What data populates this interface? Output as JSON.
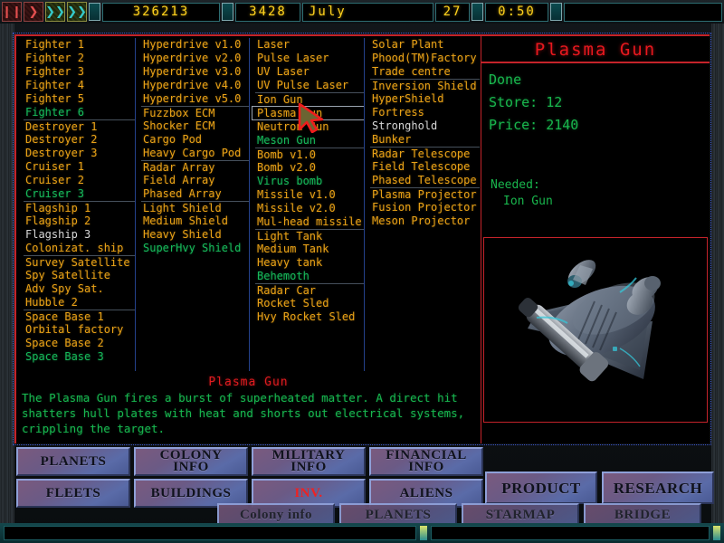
{
  "topbar": {
    "controls": [
      {
        "name": "pause-button",
        "glyph": "❙❙",
        "cls": "pause"
      },
      {
        "name": "play-button",
        "glyph": "❯",
        "cls": "play"
      },
      {
        "name": "fast-forward-button",
        "glyph": "❯❯",
        "cls": "ff"
      },
      {
        "name": "fastest-forward-button",
        "glyph": "❯❯",
        "cls": "ff"
      }
    ],
    "credits": "326213",
    "population": "3428",
    "month": "July",
    "day": "27",
    "clock": "0:50"
  },
  "columns": [
    {
      "name": "ships",
      "items": [
        {
          "label": "Fighter 1",
          "state": "built"
        },
        {
          "label": "Fighter 2",
          "state": "built"
        },
        {
          "label": "Fighter 3",
          "state": "built"
        },
        {
          "label": "Fighter 4",
          "state": "built"
        },
        {
          "label": "Fighter 5",
          "state": "built"
        },
        {
          "label": "Fighter 6",
          "state": "available"
        },
        {
          "label": "Destroyer 1",
          "state": "built",
          "sep": true
        },
        {
          "label": "Destroyer 2",
          "state": "built"
        },
        {
          "label": "Destroyer 3",
          "state": "built"
        },
        {
          "label": "Cruiser 1",
          "state": "built"
        },
        {
          "label": "Cruiser 2",
          "state": "built"
        },
        {
          "label": "Cruiser 3",
          "state": "available"
        },
        {
          "label": "Flagship 1",
          "state": "built",
          "sep": true
        },
        {
          "label": "Flagship 2",
          "state": "built"
        },
        {
          "label": "Flagship 3",
          "state": "researching"
        },
        {
          "label": "Colonizat. ship",
          "state": "built"
        },
        {
          "label": "Survey Satellite",
          "state": "built",
          "sep": true
        },
        {
          "label": "Spy Satellite",
          "state": "built"
        },
        {
          "label": "Adv Spy Sat.",
          "state": "built"
        },
        {
          "label": "Hubble 2",
          "state": "built"
        },
        {
          "label": "Space Base 1",
          "state": "built",
          "sep": true
        },
        {
          "label": "Orbital factory",
          "state": "built"
        },
        {
          "label": "Space Base 2",
          "state": "built"
        },
        {
          "label": "Space Base 3",
          "state": "available"
        }
      ]
    },
    {
      "name": "systems",
      "items": [
        {
          "label": "Hyperdrive v1.0",
          "state": "built"
        },
        {
          "label": "Hyperdrive v2.0",
          "state": "built"
        },
        {
          "label": "Hyperdrive v3.0",
          "state": "built"
        },
        {
          "label": "Hyperdrive v4.0",
          "state": "built"
        },
        {
          "label": "Hyperdrive v5.0",
          "state": "built"
        },
        {
          "label": "Fuzzbox ECM",
          "state": "built",
          "sep": true
        },
        {
          "label": "Shocker ECM",
          "state": "built"
        },
        {
          "label": "Cargo Pod",
          "state": "built"
        },
        {
          "label": "Heavy Cargo Pod",
          "state": "built"
        },
        {
          "label": "Radar Array",
          "state": "built",
          "sep": true
        },
        {
          "label": "Field Array",
          "state": "built"
        },
        {
          "label": "Phased Array",
          "state": "built"
        },
        {
          "label": "Light Shield",
          "state": "built",
          "sep": true
        },
        {
          "label": "Medium Shield",
          "state": "built"
        },
        {
          "label": "Heavy Shield",
          "state": "built"
        },
        {
          "label": "SuperHvy Shield",
          "state": "available"
        }
      ]
    },
    {
      "name": "weapons",
      "items": [
        {
          "label": "Laser",
          "state": "built"
        },
        {
          "label": "Pulse Laser",
          "state": "built"
        },
        {
          "label": "UV Laser",
          "state": "built"
        },
        {
          "label": "UV Pulse Laser",
          "state": "built"
        },
        {
          "label": "Ion Gun",
          "state": "built",
          "sep": true
        },
        {
          "label": "Plasma Gun",
          "state": "built",
          "selected": true
        },
        {
          "label": "Neutron Gun",
          "state": "built"
        },
        {
          "label": "Meson Gun",
          "state": "available"
        },
        {
          "label": "Bomb v1.0",
          "state": "built",
          "sep": true
        },
        {
          "label": "Bomb v2.0",
          "state": "built"
        },
        {
          "label": "Virus bomb",
          "state": "available"
        },
        {
          "label": "Missile v1.0",
          "state": "built"
        },
        {
          "label": "Missile v2.0",
          "state": "built"
        },
        {
          "label": "Mul-head missile",
          "state": "built"
        },
        {
          "label": "Light Tank",
          "state": "built",
          "sep": true
        },
        {
          "label": "Medium Tank",
          "state": "built"
        },
        {
          "label": "Heavy tank",
          "state": "built"
        },
        {
          "label": "Behemoth",
          "state": "available"
        },
        {
          "label": "Radar Car",
          "state": "built",
          "sep": true
        },
        {
          "label": "Rocket Sled",
          "state": "built"
        },
        {
          "label": "Hvy Rocket Sled",
          "state": "built"
        }
      ]
    },
    {
      "name": "structures",
      "items": [
        {
          "label": "Solar Plant",
          "state": "built"
        },
        {
          "label": "Phood(TM)Factory",
          "state": "built"
        },
        {
          "label": "Trade centre",
          "state": "built"
        },
        {
          "label": "Inversion Shield",
          "state": "built",
          "sep": true
        },
        {
          "label": "HyperShield",
          "state": "built"
        },
        {
          "label": "Fortress",
          "state": "built"
        },
        {
          "label": "Stronghold",
          "state": "researching"
        },
        {
          "label": "Bunker",
          "state": "built"
        },
        {
          "label": "Radar Telescope",
          "state": "built",
          "sep": true
        },
        {
          "label": "Field Telescope",
          "state": "built"
        },
        {
          "label": "Phased Telescope",
          "state": "built"
        },
        {
          "label": "Plasma Projector",
          "state": "built",
          "sep": true
        },
        {
          "label": "Fusion Projector",
          "state": "built"
        },
        {
          "label": "Meson Projector",
          "state": "built"
        }
      ]
    }
  ],
  "description": {
    "title": "Plasma Gun",
    "body": "The Plasma Gun fires a burst of superheated matter. A direct hit shatters hull plates with heat and shorts out electrical systems, crippling the target."
  },
  "detail": {
    "title": "Plasma Gun",
    "status": "Done",
    "store_label": "Store:",
    "store_value": "12",
    "price_label": "Price:",
    "price_value": "2140",
    "needed_label": "Needed:",
    "needed_items": [
      "Ion Gun"
    ]
  },
  "buttons": {
    "row1": [
      {
        "name": "planets-button",
        "l1": "PLANETS",
        "l2": ""
      },
      {
        "name": "colony-info-button",
        "l1": "COLONY",
        "l2": "INFO"
      },
      {
        "name": "military-info-button",
        "l1": "MILITARY",
        "l2": "INFO"
      },
      {
        "name": "financial-info-button",
        "l1": "FINANCIAL",
        "l2": "INFO"
      }
    ],
    "row2": [
      {
        "name": "fleets-button",
        "l1": "FLEETS",
        "l2": ""
      },
      {
        "name": "buildings-button",
        "l1": "BUILDINGS",
        "l2": ""
      },
      {
        "name": "inventory-button",
        "l1": "INV.",
        "l2": "",
        "active": true
      },
      {
        "name": "aliens-button",
        "l1": "ALIENS",
        "l2": ""
      }
    ],
    "row3": [
      {
        "name": "product-button",
        "l1": "PRODUCT",
        "l2": ""
      },
      {
        "name": "research-button",
        "l1": "RESEARCH",
        "l2": ""
      }
    ],
    "row4": [
      {
        "name": "colony-info-bottom-button",
        "l1": "Colony info",
        "l2": ""
      },
      {
        "name": "planets-bottom-button",
        "l1": "PLANETS",
        "l2": ""
      },
      {
        "name": "starmap-bottom-button",
        "l1": "STARMAP",
        "l2": ""
      },
      {
        "name": "bridge-bottom-button",
        "l1": "BRIDGE",
        "l2": ""
      }
    ]
  },
  "colors": {
    "item_built": "#e8a117",
    "item_available": "#17b85a",
    "item_researching": "#d8d8d8",
    "accent_red": "#c4232a",
    "text_green": "#19b64d",
    "lcd_yellow": "#ffd21e"
  }
}
